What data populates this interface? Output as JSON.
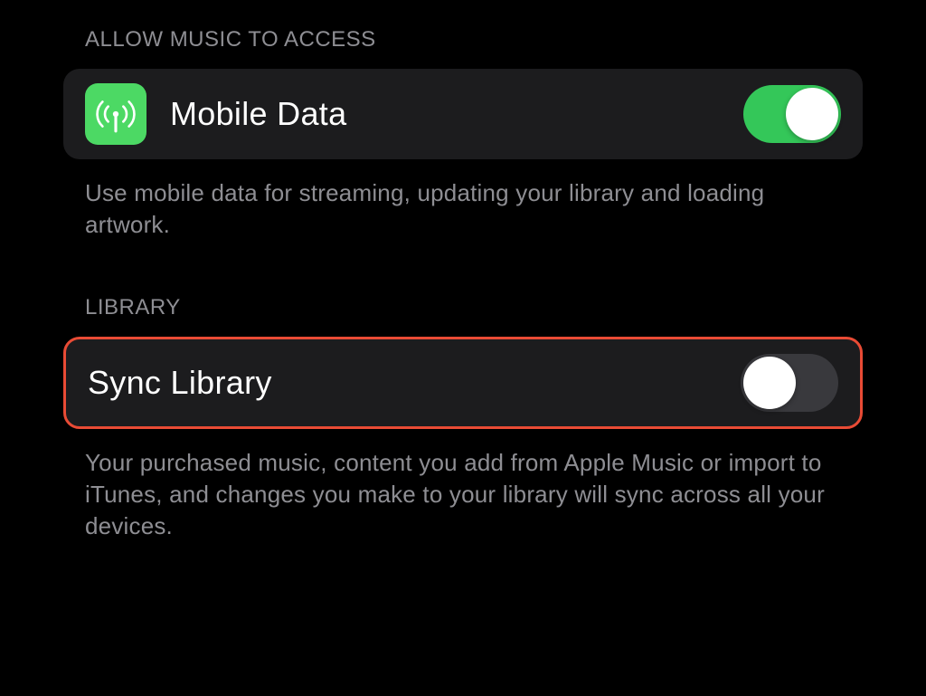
{
  "sections": {
    "access": {
      "header": "ALLOW MUSIC TO ACCESS",
      "mobile_data": {
        "label": "Mobile Data",
        "icon": "antenna-icon",
        "enabled": true
      },
      "description": "Use mobile data for streaming, updating your library and loading artwork."
    },
    "library": {
      "header": "LIBRARY",
      "sync_library": {
        "label": "Sync Library",
        "enabled": false,
        "highlighted": true
      },
      "description": "Your purchased music, content you add from Apple Music or import to iTunes, and changes you make to your library will sync across all your devices."
    }
  }
}
